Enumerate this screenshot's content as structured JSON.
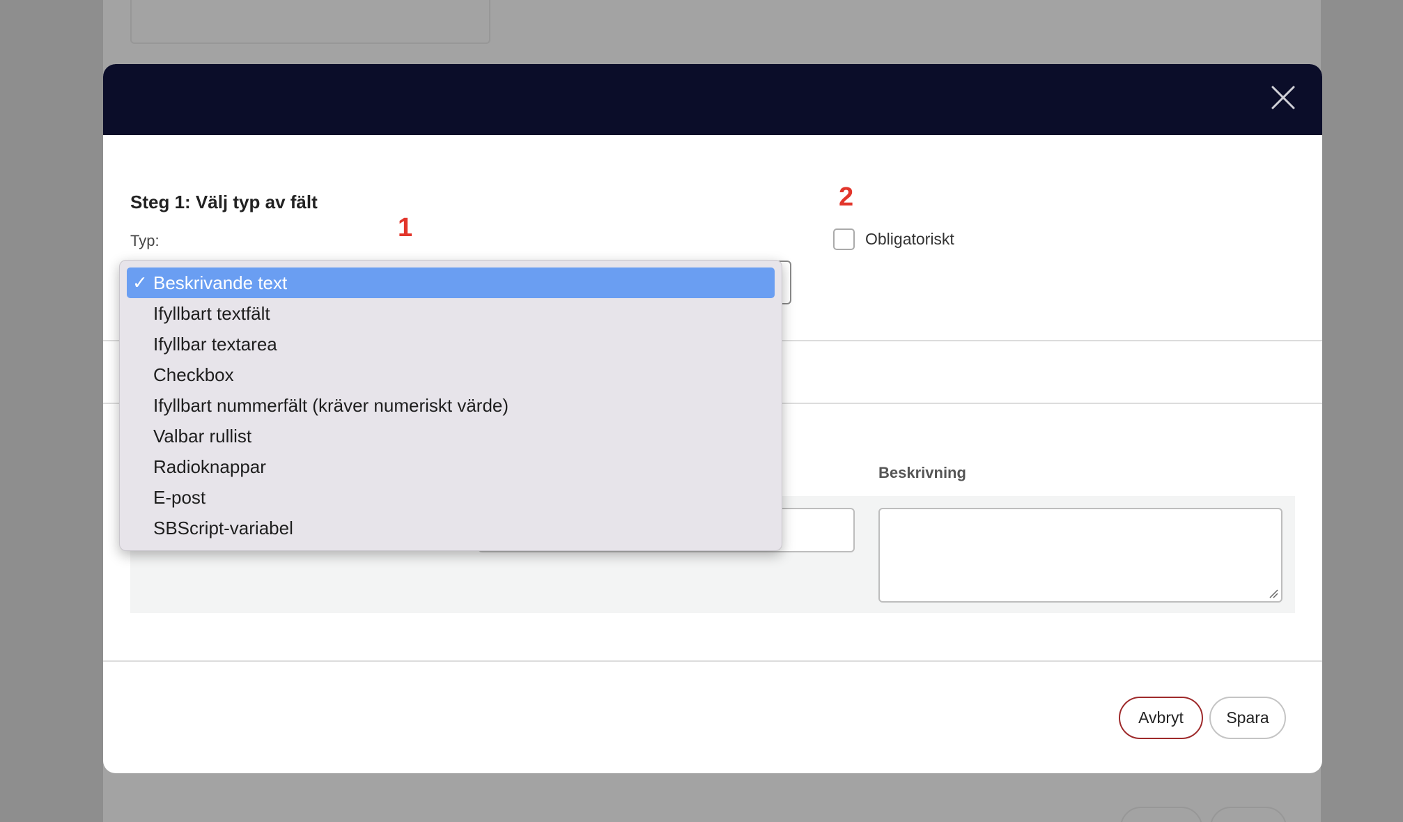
{
  "modal": {
    "step_title": "Steg 1: Välj typ av fält",
    "type_label": "Typ:",
    "required_label": "Obligatoriskt",
    "required_checked": false,
    "description_label": "Beskrivning",
    "annotations": [
      "1",
      "2"
    ],
    "header_color": "#0b0d29"
  },
  "dropdown": {
    "selected_index": 0,
    "options": [
      "Beskrivande text",
      "Ifyllbart textfält",
      "Ifyllbar textarea",
      "Checkbox",
      "Ifyllbart nummerfält (kräver numeriskt värde)",
      "Valbar rullist",
      "Radioknappar",
      "E-post",
      "SBScript-variabel"
    ]
  },
  "footer": {
    "cancel_label": "Avbryt",
    "save_label": "Spara"
  },
  "icons": {
    "close": "close-icon",
    "selected_check": "checkmark-icon"
  },
  "colors": {
    "accent_selected": "#6a9ef2",
    "cancel_border": "#9e2a2b",
    "annotation": "#e2352b"
  }
}
